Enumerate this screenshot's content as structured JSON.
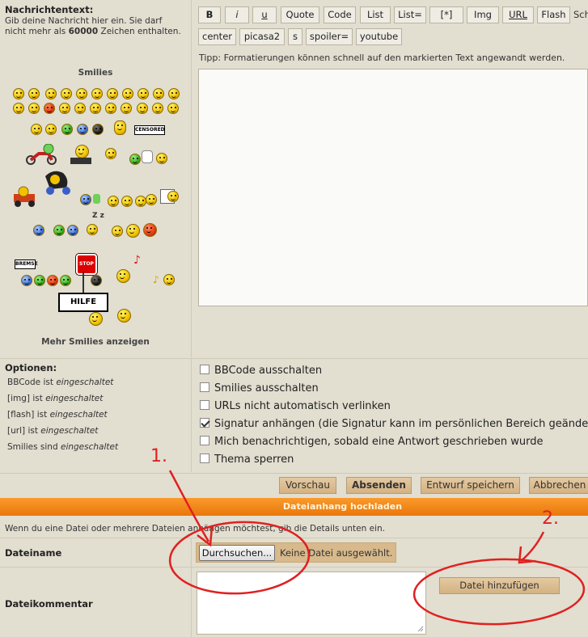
{
  "message": {
    "label": "Nachrichtentext:",
    "help": "Gib deine Nachricht hier ein. Sie darf nicht mehr als",
    "limit": "60000",
    "help_suffix": "Zeichen enthalten."
  },
  "smilies": {
    "title": "Smilies",
    "censored": "CENSORED",
    "bremse": "BREMSE",
    "stop": "STOP",
    "hilfe": "HILFE",
    "more": "Mehr Smilies anzeigen"
  },
  "toolbar": {
    "buttons": [
      "B",
      "i",
      "u",
      "Quote",
      "Code",
      "List",
      "List=",
      "[*]",
      "Img",
      "URL",
      "Flash",
      "Sch"
    ],
    "buttons_row2": [
      "center",
      "picasa2",
      "s",
      "spoiler=",
      "youtube"
    ],
    "tip": "Tipp: Formatierungen können schnell auf den markierten Text angewandt werden."
  },
  "options": {
    "label": "Optionen:",
    "status": [
      {
        "name": "BBCode",
        "word": "ist",
        "state": "eingeschaltet"
      },
      {
        "name": "[img]",
        "word": "ist",
        "state": "eingeschaltet"
      },
      {
        "name": "[flash]",
        "word": "ist",
        "state": "eingeschaltet"
      },
      {
        "name": "[url]",
        "word": "ist",
        "state": "eingeschaltet"
      },
      {
        "name": "Smilies",
        "word": "sind",
        "state": "eingeschaltet"
      }
    ],
    "checkboxes": [
      {
        "label": "BBCode ausschalten",
        "checked": false
      },
      {
        "label": "Smilies ausschalten",
        "checked": false
      },
      {
        "label": "URLs nicht automatisch verlinken",
        "checked": false
      },
      {
        "label": "Signatur anhängen (die Signatur kann im persönlichen Bereich geändert w",
        "checked": true
      },
      {
        "label": "Mich benachrichtigen, sobald eine Antwort geschrieben wurde",
        "checked": false
      },
      {
        "label": "Thema sperren",
        "checked": false
      }
    ]
  },
  "actions": {
    "preview": "Vorschau",
    "submit": "Absenden",
    "draft": "Entwurf speichern",
    "cancel": "Abbrechen"
  },
  "attachment": {
    "title": "Dateianhang hochladen",
    "info": "Wenn du eine Datei oder mehrere Dateien anhängen möchtest, gib die Details unten ein.",
    "filename_label": "Dateiname",
    "browse": "Durchsuchen...",
    "no_file": "Keine Datei ausgewählt.",
    "comment_label": "Dateikommentar",
    "add_file": "Datei hinzufügen"
  },
  "annotations": {
    "one": "1.",
    "two": "2.",
    "color": "#e02020"
  }
}
